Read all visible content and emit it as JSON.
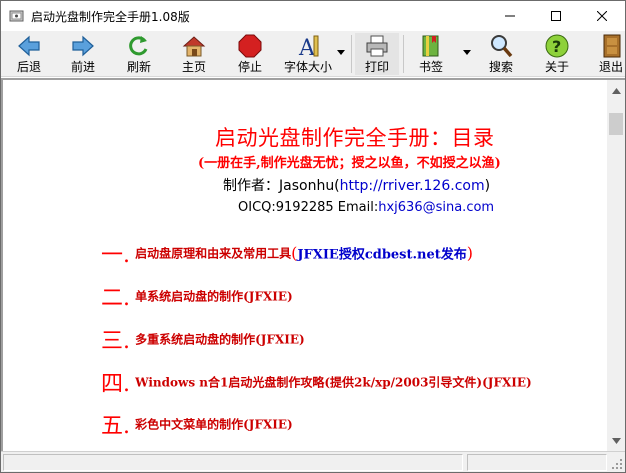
{
  "window": {
    "title": "启动光盘制作完全手册1.08版",
    "app_icon": "book-disc-icon"
  },
  "toolbar": {
    "items": [
      {
        "label": "后退",
        "icon": "back-arrow-icon"
      },
      {
        "label": "前进",
        "icon": "forward-arrow-icon"
      },
      {
        "label": "刷新",
        "icon": "refresh-icon"
      },
      {
        "label": "主页",
        "icon": "home-icon"
      },
      {
        "label": "停止",
        "icon": "stop-icon"
      },
      {
        "label": "字体大小",
        "icon": "font-size-icon"
      },
      {
        "label": "打印",
        "icon": "printer-icon"
      },
      {
        "label": "书签",
        "icon": "bookmark-icon"
      },
      {
        "label": "搜索",
        "icon": "search-icon"
      },
      {
        "label": "关于",
        "icon": "help-icon"
      },
      {
        "label": "退出",
        "icon": "exit-door-icon"
      }
    ]
  },
  "document": {
    "title": "启动光盘制作完全手册：目录",
    "subtitle": "(一册在手,制作光盘无忧；授之以鱼，不如授之以渔)",
    "author_prefix": "制作者：Jasonhu(",
    "author_link": "http://rriver.126.com",
    "author_suffix": ")",
    "contact_prefix": "OICQ:9192285 Email:",
    "contact_email": "hxj636@sina.com",
    "toc": [
      {
        "num": "一.",
        "text": "启动盘原理和由来及常用工具",
        "credit": "JFXIE授权cdbest.net发布"
      },
      {
        "num": "二.",
        "text": "单系统启动盘的制作(JFXIE)"
      },
      {
        "num": "三.",
        "text": "多重系统启动盘的制作(JFXIE)"
      },
      {
        "num": "四.",
        "text": "Windows n合1启动光盘制作攻略(提供2k/xp/2003引导文件)(JFXIE)"
      },
      {
        "num": "五.",
        "text": "彩色中文菜单的制作(JFXIE)"
      }
    ]
  },
  "colors": {
    "heading_red": "#ff0000",
    "toc_red": "#cc0000",
    "link_blue": "#0000cc",
    "toolbar_bg": "#f0f0f0"
  }
}
